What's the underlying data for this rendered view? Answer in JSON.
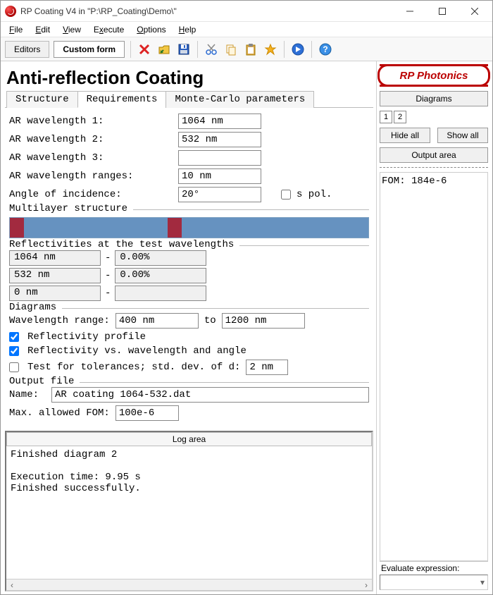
{
  "window": {
    "title": "RP Coating V4 in \"P:\\RP_Coating\\Demo\\\""
  },
  "menubar": [
    "File",
    "Edit",
    "View",
    "Execute",
    "Options",
    "Help"
  ],
  "toolbar": {
    "editors": "Editors",
    "custom_form": "Custom form"
  },
  "page_title": "Anti-reflection Coating",
  "tabs": [
    "Structure",
    "Requirements",
    "Monte-Carlo parameters"
  ],
  "active_tab_index": 1,
  "requirements": {
    "labels": {
      "wl1": "AR wavelength 1:",
      "wl2": "AR wavelength 2:",
      "wl3": "AR wavelength 3:",
      "ranges": "AR wavelength ranges:",
      "angle": "Angle of incidence:",
      "spol": "s pol."
    },
    "values": {
      "wl1": "1064 nm",
      "wl2": "532 nm",
      "wl3": "",
      "ranges": "10 nm",
      "angle": "20°"
    },
    "spol_checked": false
  },
  "multilayer": {
    "label": "Multilayer structure",
    "segments": [
      {
        "color": "r",
        "pct": 4
      },
      {
        "color": "b",
        "pct": 40
      },
      {
        "color": "r",
        "pct": 4
      },
      {
        "color": "b",
        "pct": 52
      }
    ]
  },
  "reflectivities": {
    "label": "Reflectivities at the test wavelengths",
    "rows": [
      {
        "wavelength": "1064 nm",
        "value": "0.00%"
      },
      {
        "wavelength": "532 nm",
        "value": "0.00%"
      },
      {
        "wavelength": "0 nm",
        "value": ""
      }
    ],
    "dash": "-"
  },
  "diagrams": {
    "label": "Diagrams",
    "range_label": "Wavelength range:",
    "range_to": "to",
    "range_from": "400 nm",
    "range_to_val": "1200 nm",
    "cb_profile": "Reflectivity profile",
    "cb_profile_checked": true,
    "cb_angle": "Reflectivity vs. wavelength and angle",
    "cb_angle_checked": true,
    "cb_tol": "Test for tolerances; std. dev. of d:",
    "cb_tol_checked": false,
    "tol_val": "2 nm"
  },
  "output": {
    "label": "Output file",
    "name_label": "Name:",
    "name_val": "AR coating 1064-532.dat",
    "fom_label": "Max. allowed FOM:",
    "fom_val": "100e-6"
  },
  "log": {
    "header": "Log area",
    "body": "Finished diagram 2\n\nExecution time: 9.95 s\nFinished successfully."
  },
  "right": {
    "logo_text": "RP Photonics",
    "diagrams_hdr": "Diagrams",
    "num_buttons": [
      "1",
      "2"
    ],
    "hide_all": "Hide all",
    "show_all": "Show all",
    "output_area_hdr": "Output area",
    "output_text": "FOM: 184e-6",
    "eval_label": "Evaluate expression:"
  }
}
